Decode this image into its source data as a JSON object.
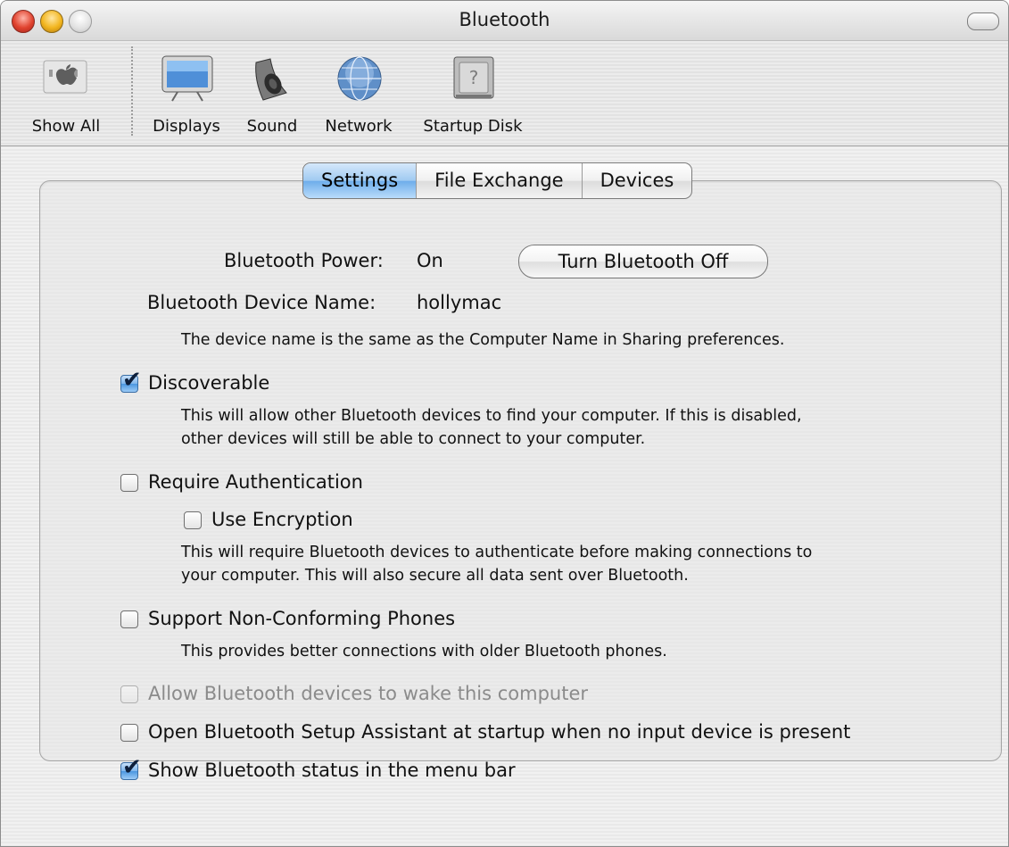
{
  "window": {
    "title": "Bluetooth"
  },
  "toolbar": {
    "items": [
      {
        "label": "Show All",
        "icon": "apple-icon"
      },
      {
        "label": "Displays",
        "icon": "display-icon"
      },
      {
        "label": "Sound",
        "icon": "speaker-icon"
      },
      {
        "label": "Network",
        "icon": "network-globe-icon"
      },
      {
        "label": "Startup Disk",
        "icon": "hard-disk-icon"
      }
    ]
  },
  "tabs": [
    "Settings",
    "File Exchange",
    "Devices"
  ],
  "active_tab": "Settings",
  "settings": {
    "power_label": "Bluetooth Power:",
    "power_value": "On",
    "power_button": "Turn Bluetooth Off",
    "device_name_label": "Bluetooth Device Name:",
    "device_name_value": "hollymac",
    "device_name_note": "The device name is the same as the Computer Name in Sharing preferences.",
    "discoverable": {
      "label": "Discoverable",
      "checked": true,
      "desc_1": "This will allow other Bluetooth devices to find your computer.  If this is disabled,",
      "desc_2": "other devices will still be able to connect to your computer."
    },
    "require_auth": {
      "label": "Require Authentication",
      "checked": false
    },
    "use_encryption": {
      "label": "Use Encryption",
      "checked": false,
      "desc_1": "This will require Bluetooth devices to authenticate before making connections to",
      "desc_2": "your computer. This will also secure all data sent over Bluetooth."
    },
    "non_conforming": {
      "label": "Support Non-Conforming Phones",
      "checked": false,
      "desc_1": "This provides better connections with older Bluetooth phones."
    },
    "allow_wake": {
      "label": "Allow Bluetooth devices to wake this computer",
      "checked": false,
      "disabled": true
    },
    "open_assistant": {
      "label": "Open Bluetooth Setup Assistant at startup when no input device is present",
      "checked": false
    },
    "show_status": {
      "label": "Show Bluetooth status in the menu bar",
      "checked": true
    }
  },
  "colors": {
    "accent_blue": "#6eadea",
    "close_red": "#e0432f",
    "minimize_yellow": "#f2b51e"
  }
}
